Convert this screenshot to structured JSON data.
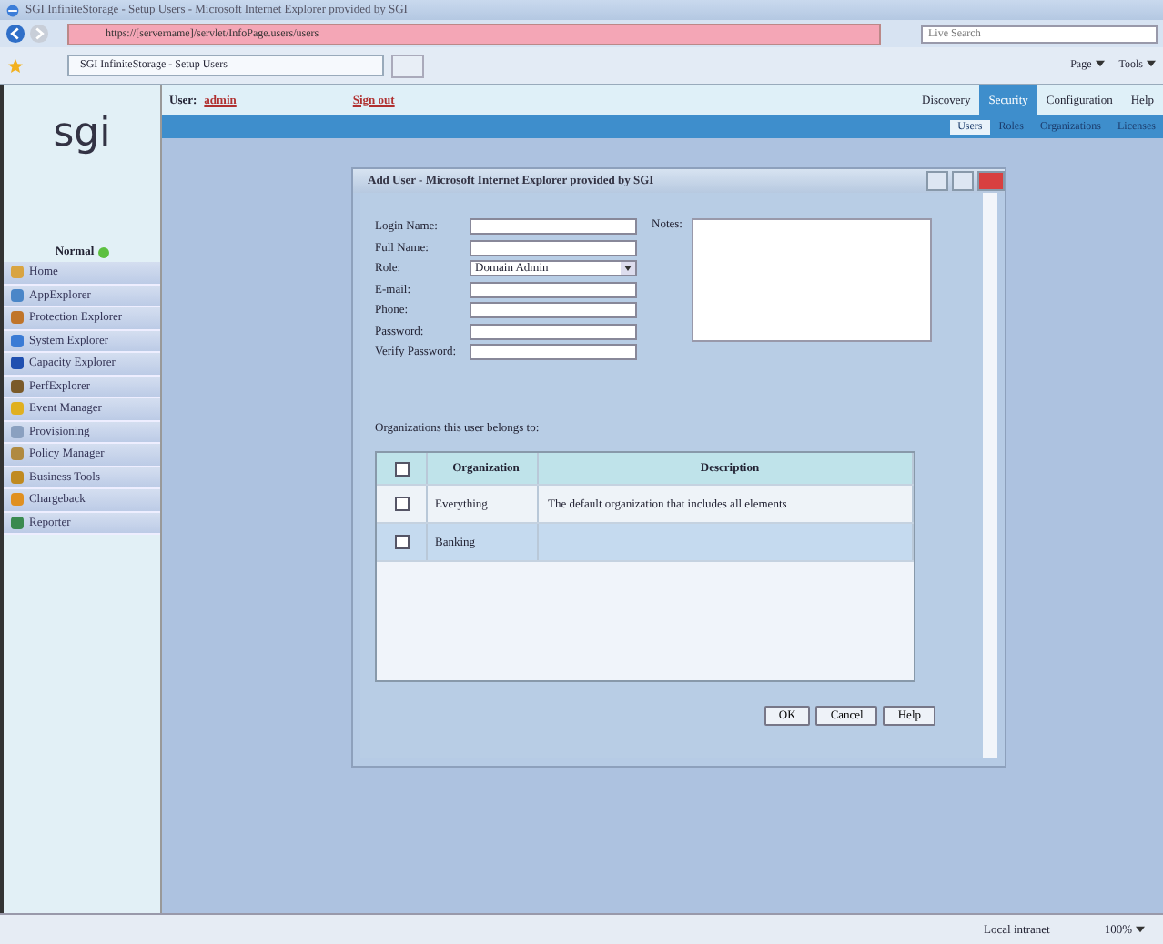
{
  "browser": {
    "title": "SGI InfiniteStorage - Setup Users - Microsoft Internet Explorer provided by SGI",
    "address": "https://[servername]/servlet/InfoPage.users/users",
    "search_placeholder": "Live Search",
    "tab_title": "SGI InfiniteStorage - Setup Users",
    "page_menu": "Page",
    "tools_menu": "Tools",
    "zone": "Local intranet",
    "zoom": "100%"
  },
  "header": {
    "user_label": "User:",
    "user": "admin",
    "signout": "Sign out",
    "nav": [
      {
        "label": "Discovery",
        "selected": false
      },
      {
        "label": "Security",
        "selected": true
      },
      {
        "label": "Configuration",
        "selected": false
      },
      {
        "label": "Help",
        "selected": false
      }
    ],
    "subnav": [
      {
        "label": "Users",
        "selected": true
      },
      {
        "label": "Roles",
        "selected": false
      },
      {
        "label": "Organizations",
        "selected": false
      },
      {
        "label": "Licenses",
        "selected": false
      }
    ]
  },
  "sidebar": {
    "logo": "sgi",
    "status": "Normal",
    "items": [
      {
        "label": "Home"
      },
      {
        "label": "AppExplorer"
      },
      {
        "label": "Protection Explorer"
      },
      {
        "label": "System Explorer"
      },
      {
        "label": "Capacity Explorer"
      },
      {
        "label": "PerfExplorer"
      },
      {
        "label": "Event Manager"
      },
      {
        "label": "Provisioning"
      },
      {
        "label": "Policy Manager"
      },
      {
        "label": "Business Tools"
      },
      {
        "label": "Chargeback"
      },
      {
        "label": "Reporter"
      }
    ]
  },
  "dialog": {
    "title": "Add User - Microsoft Internet Explorer provided by SGI",
    "fields": [
      {
        "label": "Login Name:",
        "kind": "text"
      },
      {
        "label": "Full Name:",
        "kind": "text"
      },
      {
        "label": "Role:",
        "kind": "select",
        "value": "Domain Admin"
      },
      {
        "label": "E-mail:",
        "kind": "text"
      },
      {
        "label": "Phone:",
        "kind": "text"
      },
      {
        "label": "Password:",
        "kind": "password"
      },
      {
        "label": "Verify Password:",
        "kind": "password"
      }
    ],
    "notes_label": "Notes:",
    "orgs_label": "Organizations this user belongs to:",
    "table": {
      "header_checked": false,
      "columns": [
        "Organization",
        "Description"
      ],
      "rows": [
        {
          "checked": false,
          "organization": "Everything",
          "description": "The default organization that includes all elements"
        },
        {
          "checked": false,
          "organization": "Banking",
          "description": ""
        }
      ]
    },
    "buttons": [
      "OK",
      "Cancel",
      "Help"
    ]
  }
}
